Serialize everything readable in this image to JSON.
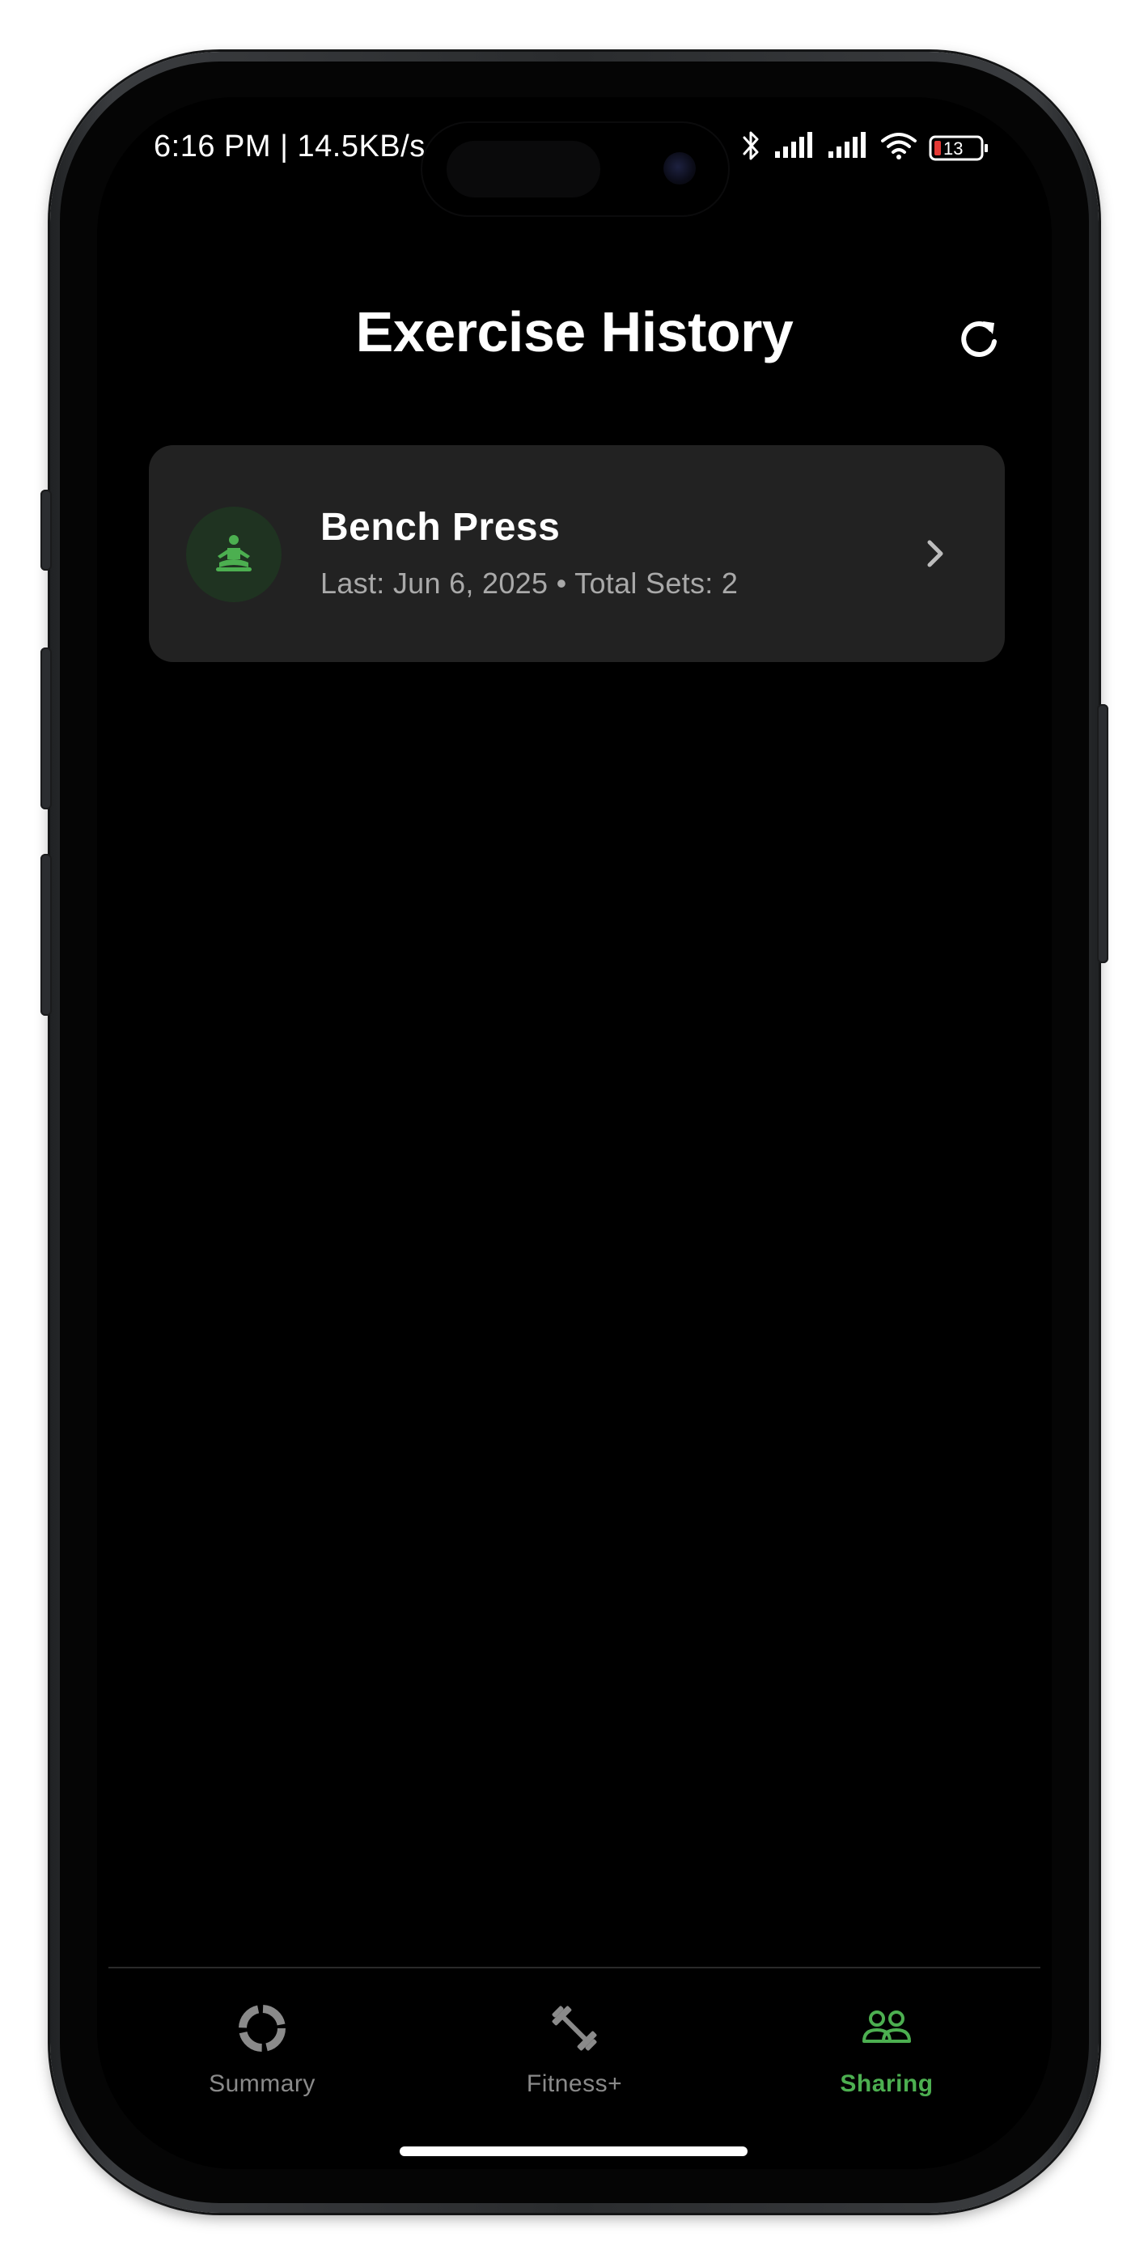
{
  "status_bar": {
    "time_text": "6:16 PM | 14.5KB/s",
    "battery_level": "13"
  },
  "header": {
    "title": "Exercise History"
  },
  "exercise_list": [
    {
      "name": "Bench Press",
      "details": "Last: Jun 6, 2025 • Total Sets: 2",
      "icon": "meditation-figure-icon"
    }
  ],
  "tabs": [
    {
      "label": "Summary",
      "icon": "activity-ring-icon",
      "active": false
    },
    {
      "label": "Fitness+",
      "icon": "dumbbell-icon",
      "active": false
    },
    {
      "label": "Sharing",
      "icon": "people-icon",
      "active": true
    }
  ],
  "colors": {
    "accent": "#4caf50",
    "background": "#000000",
    "card": "#222222",
    "muted": "#8a8a8a",
    "battery_low": "#e53935"
  }
}
